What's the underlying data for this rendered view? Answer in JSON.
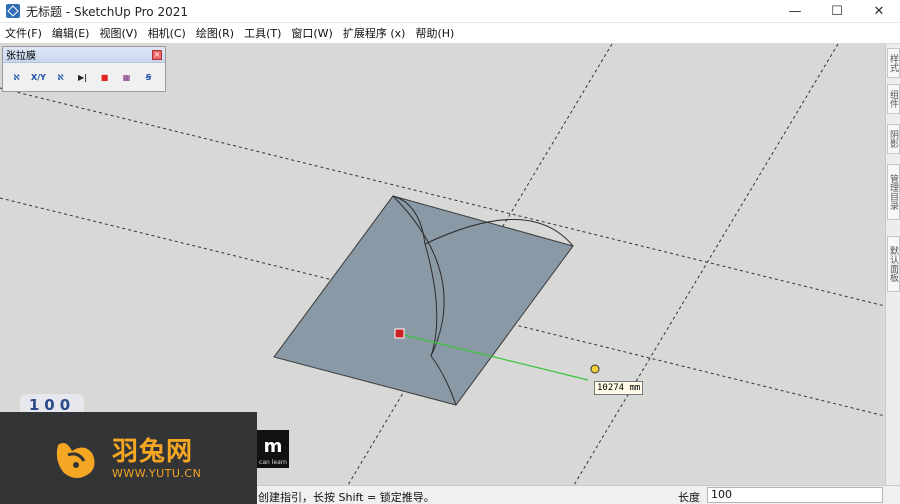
{
  "window": {
    "title": "无标题 - SketchUp Pro 2021",
    "minimize": "—",
    "maximize": "☐",
    "close": "✕"
  },
  "menu": [
    {
      "label": "文件(F)"
    },
    {
      "label": "编辑(E)"
    },
    {
      "label": "视图(V)"
    },
    {
      "label": "相机(C)"
    },
    {
      "label": "绘图(R)"
    },
    {
      "label": "工具(T)"
    },
    {
      "label": "窗口(W)"
    },
    {
      "label": "扩展程序 (x)"
    },
    {
      "label": "帮助(H)"
    }
  ],
  "toolbar": {
    "title": "张拉膜",
    "close": "×",
    "icons": [
      {
        "name": "membrane-tool-1-icon",
        "glyph": "ℵ"
      },
      {
        "name": "membrane-xy-icon",
        "glyph": "X/Y"
      },
      {
        "name": "membrane-tool-3-icon",
        "glyph": "ℵ"
      },
      {
        "name": "play-icon",
        "glyph": "▶|"
      },
      {
        "name": "stop-icon",
        "glyph": "■"
      },
      {
        "name": "grid-icon",
        "glyph": "▦"
      },
      {
        "name": "spiral-icon",
        "glyph": "Ꞩ"
      }
    ]
  },
  "tray_tabs": [
    {
      "label": "样式"
    },
    {
      "label": "组件"
    },
    {
      "label": "阴影"
    },
    {
      "label": "管理目录"
    },
    {
      "label": "默认面板"
    }
  ],
  "viewport": {
    "scale_badge": "100",
    "tooltip": "10274 mm",
    "colors": {
      "background": "#d8d8d6",
      "face": "#8a99a6",
      "inference": "#3cc43c",
      "endpoint": "#cc2222"
    }
  },
  "status": {
    "text": "创建指引，长按 Shift = 锁定推导。",
    "measure_label": "长度",
    "measure_value": "100"
  },
  "watermark": {
    "brand": "羽兔网",
    "url": "WWW.YUTU.CN",
    "logo_letter": "m",
    "logo_sub": "can learn"
  }
}
